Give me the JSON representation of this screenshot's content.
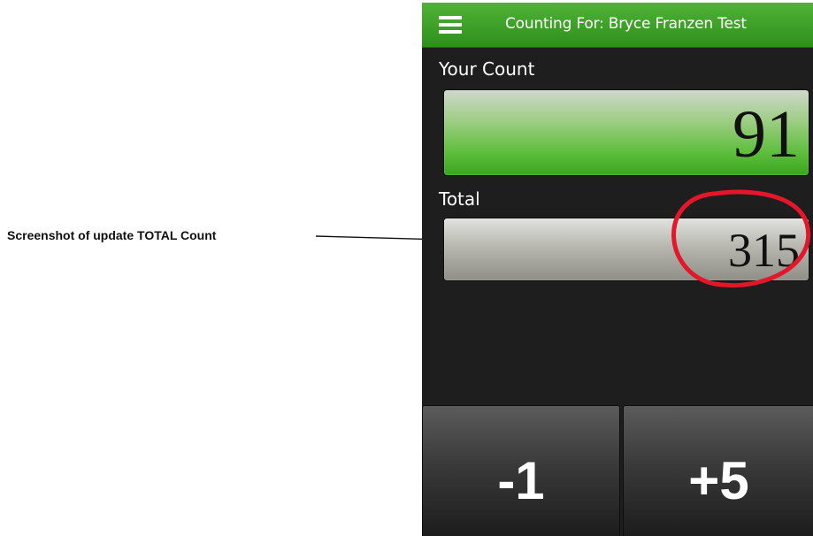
{
  "annotation": {
    "label": "Screenshot of update TOTAL Count",
    "highlight_color": "#e3162a"
  },
  "app": {
    "header": {
      "menu_icon": "hamburger-menu-icon",
      "title": "Counting For: Bryce Franzen Test"
    },
    "your_count": {
      "label": "Your Count",
      "value": "91"
    },
    "total": {
      "label": "Total",
      "value": "315"
    },
    "buttons": {
      "decrement_label": "-1",
      "increment_label": "+5"
    },
    "colors": {
      "header_green": "#3a9e26",
      "count_green": "#5cbd3a",
      "background": "#1e1e1e"
    }
  }
}
